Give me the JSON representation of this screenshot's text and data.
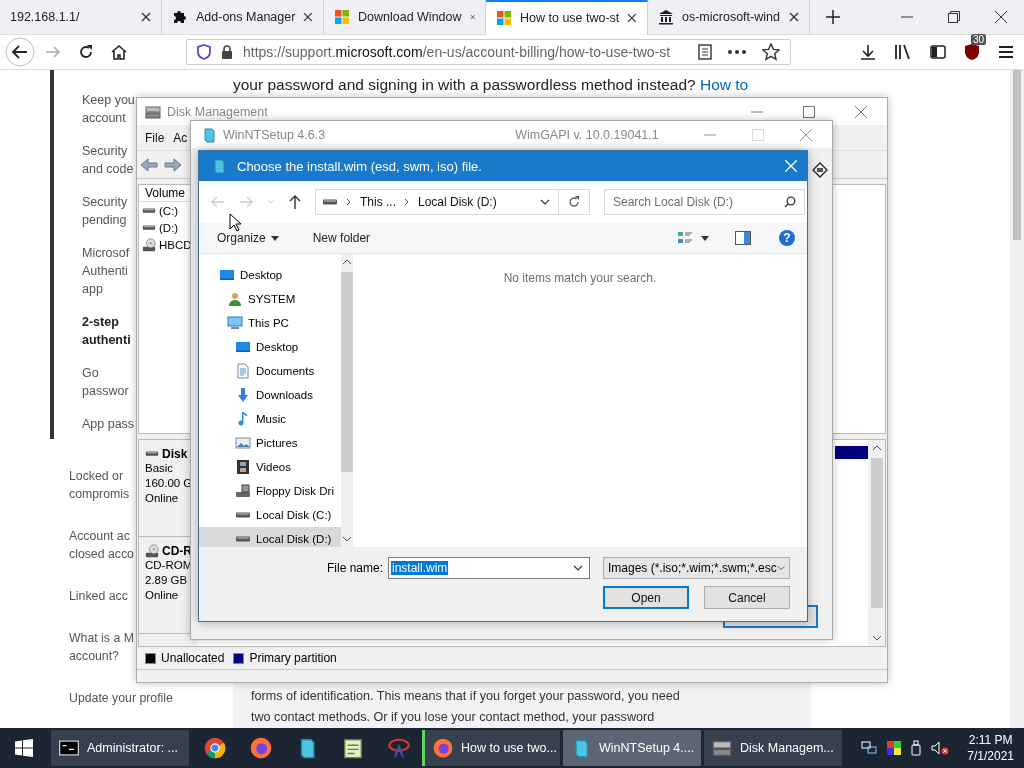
{
  "browser": {
    "tabs": [
      {
        "title": "192.168.1.1/",
        "selected": false
      },
      {
        "title": "Add-ons Manager",
        "selected": false
      },
      {
        "title": "Download Window",
        "selected": false
      },
      {
        "title": "How to use two-st",
        "selected": true
      },
      {
        "title": "os-microsoft-wind",
        "selected": false
      }
    ],
    "url": "https://support.**microsoft.com**/en-us/account-billing/how-to-use-two-st",
    "badge": "30"
  },
  "page": {
    "nav_items": [
      {
        "lines": [
          "Keep you",
          "account"
        ],
        "selected": false
      },
      {
        "lines": [
          "Security",
          "and code"
        ],
        "selected": false
      },
      {
        "lines": [
          "Security",
          "pending"
        ],
        "selected": false
      },
      {
        "lines": [
          "Microsof",
          "Authenti",
          "app"
        ],
        "selected": false
      },
      {
        "lines": [
          "2-step",
          "authenti"
        ],
        "selected": true
      },
      {
        "lines": [
          "Go",
          "passwor"
        ],
        "selected": false
      },
      {
        "lines": [
          "App pass"
        ],
        "selected": false
      }
    ],
    "outer_items": [
      {
        "lines": [
          "Locked or",
          "compromis"
        ]
      },
      {
        "lines": [
          "Account ac",
          "closed acco"
        ]
      },
      {
        "lines": [
          "Linked acc"
        ]
      },
      {
        "lines": [
          "What is a M",
          "account?"
        ]
      },
      {
        "lines": [
          "Update your profile"
        ]
      }
    ],
    "top_text": "your password and signing in with a passwordless method instead?",
    "top_link": "How to",
    "bottom_lines": [
      "forms of identification. This means that if you forget your password, you need",
      "two contact methods. Or if you lose your contact method, your password"
    ]
  },
  "disk_management": {
    "title": "Disk Management",
    "menu": [
      "File",
      "Ac"
    ],
    "volume_header": "Volume",
    "volumes": [
      {
        "name": "(C:)",
        "kind": "drive"
      },
      {
        "name": "(D:)",
        "kind": "drive"
      },
      {
        "name": "HBCD",
        "kind": "cd"
      }
    ],
    "disks": [
      {
        "name": "Disk",
        "kind": "drive",
        "lines": [
          "Basic",
          "160.00 G",
          "Online"
        ]
      },
      {
        "name": "CD-R",
        "kind": "cd",
        "lines": [
          "CD-ROM",
          "2.89 GB",
          "Online"
        ]
      }
    ],
    "legend": [
      {
        "label": "Unallocated",
        "color": "#000000"
      },
      {
        "label": "Primary partition",
        "color": "#000080"
      }
    ]
  },
  "winntsetup": {
    "title": "WinNTSetup 4.6.3",
    "subtitle": "WimGAPI v. 10.0.19041.1"
  },
  "dialog": {
    "title": "Choose the install.wim (esd, swm, iso) file.",
    "breadcrumb": [
      "This ...",
      "Local Disk (D:)"
    ],
    "search_placeholder": "Search Local Disk (D:)",
    "organize": "Organize",
    "new_folder": "New folder",
    "help": "?",
    "tree": [
      {
        "label": "Desktop",
        "kind": "desktop",
        "selected": false,
        "children": [
          {
            "label": "SYSTEM",
            "kind": "user",
            "selected": false
          },
          {
            "label": "This PC",
            "kind": "pc",
            "selected": false,
            "children": [
              {
                "label": "Desktop",
                "kind": "desktop",
                "selected": false
              },
              {
                "label": "Documents",
                "kind": "documents",
                "selected": false
              },
              {
                "label": "Downloads",
                "kind": "downloads",
                "selected": false
              },
              {
                "label": "Music",
                "kind": "music",
                "selected": false
              },
              {
                "label": "Pictures",
                "kind": "pictures",
                "selected": false
              },
              {
                "label": "Videos",
                "kind": "videos",
                "selected": false
              },
              {
                "label": "Floppy Disk Dri",
                "kind": "floppy",
                "selected": false
              },
              {
                "label": "Local Disk (C:)",
                "kind": "drive",
                "selected": false
              },
              {
                "label": "Local Disk (D:)",
                "kind": "drive",
                "selected": true
              }
            ]
          }
        ]
      }
    ],
    "empty_message": "No items match your search.",
    "file_name_label": "File name:",
    "file_name": "install.wim",
    "file_type": "Images (*.iso;*.wim;*.swm;*.esc",
    "buttons": [
      {
        "label": "Open",
        "default": true
      },
      {
        "label": "Cancel",
        "default": false
      }
    ]
  },
  "taskbar": {
    "items": [
      {
        "kind": "window",
        "label": "Administrator: ...",
        "selected": false,
        "attention": false
      },
      {
        "kind": "pinned"
      },
      {
        "kind": "pinned"
      },
      {
        "kind": "pinned"
      },
      {
        "kind": "pinned"
      },
      {
        "kind": "pinned"
      },
      {
        "kind": "window",
        "label": "How to use two...",
        "selected": false,
        "attention": true
      },
      {
        "kind": "window",
        "label": "WinNTSetup 4....",
        "selected": true,
        "attention": false
      },
      {
        "kind": "window",
        "label": "Disk Managem...",
        "selected": false,
        "attention": false
      }
    ],
    "time": "2:11 PM",
    "date": "7/1/2021"
  }
}
